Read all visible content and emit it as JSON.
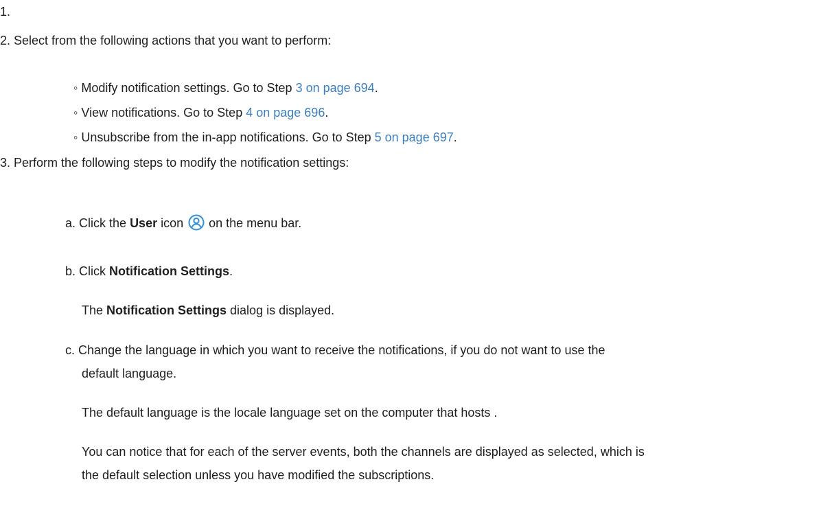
{
  "list": {
    "item1": {
      "number": "1."
    },
    "item2": {
      "number": "2.",
      "text": "Select from the following actions that you want to perform:",
      "bullet": "◦",
      "sub_items": [
        {
          "text_before": "Modify notification settings. Go to Step ",
          "link": "3 on page 694",
          "text_after": "."
        },
        {
          "text_before": "View notifications. Go to Step ",
          "link": "4 on page 696",
          "text_after": "."
        },
        {
          "text_before": "Unsubscribe from the in-app notifications. Go to Step ",
          "link": "5 on page 697",
          "text_after": "."
        }
      ]
    },
    "item3": {
      "number": "3.",
      "text": "Perform the following steps to modify the notification settings:",
      "step_a": {
        "letter": "a.",
        "click": "Click the ",
        "user_bold": "User",
        "icon_word": " icon ",
        "after_icon": " on the menu bar.",
        "icon": "user-icon",
        "icon_color": "#2f8fd8"
      },
      "step_b": {
        "letter": "b.",
        "click": "Click ",
        "bold": "Notification Settings",
        "period": ".",
        "result_the": "The ",
        "result_bold": "Notification Settings",
        "result_after": " dialog is displayed."
      },
      "step_c": {
        "letter": "c.",
        "line1": "Change the language in which you want to receive the notifications, if you do not want to use the",
        "line2": "default language.",
        "para1": "The default language is the locale language set on the computer that hosts .",
        "para2_line1": "You can notice that for each of the server events, both the channels are displayed as selected, which is",
        "para2_line2": "the default selection unless you have modified the subscriptions."
      }
    }
  }
}
